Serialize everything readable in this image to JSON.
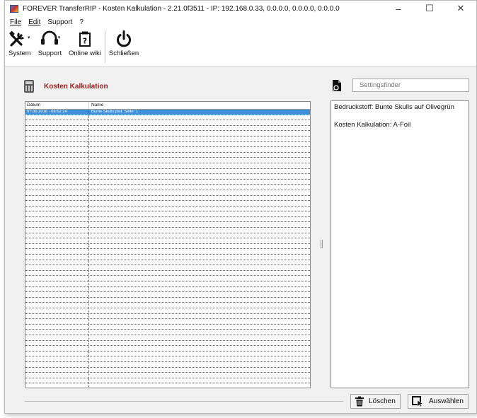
{
  "window": {
    "title": "FOREVER TransferRIP - Kosten Kalkulation - 2.21.0f3511 - IP: 192.168.0.33, 0.0.0.0, 0.0.0.0, 0.0.0.0",
    "controls": {
      "minimize": "–",
      "maximize": "☐",
      "close": "✕"
    }
  },
  "menu": {
    "items": [
      "File",
      "Edit",
      "Support",
      "?"
    ]
  },
  "toolbar": {
    "system_label": "System",
    "support_label": "Support",
    "wiki_label": "Online wiki",
    "close_label": "Schließen",
    "icons": [
      "tools-icon",
      "headset-icon",
      "clipboard-help-icon",
      "power-icon"
    ]
  },
  "section": {
    "title": "Kosten Kalkulation",
    "icon": "calculator-icon"
  },
  "table": {
    "columns": [
      "Datum",
      "Name"
    ],
    "rows": [
      {
        "date": "07.06.2016 - 09:52:24",
        "name": "Bunte Skulls.psd, Seite: 1",
        "selected": true
      }
    ],
    "empty_rows": 52,
    "selection_color": "#3d8fd8"
  },
  "settingsfinder": {
    "placeholder": "Settingsfinder",
    "icon": "file-search-icon"
  },
  "info": {
    "lines": [
      "Bedruckstoff: Bunte Skulls auf Olivegrün",
      "Kosten Kalkulation: A-Foil"
    ]
  },
  "buttons": {
    "delete_label": "Löschen",
    "select_label": "Auswählen",
    "icons": [
      "trash-icon",
      "cursor-select-icon"
    ]
  },
  "colors": {
    "accent_title": "#9b1b1b",
    "selection": "#3d8fd8"
  }
}
